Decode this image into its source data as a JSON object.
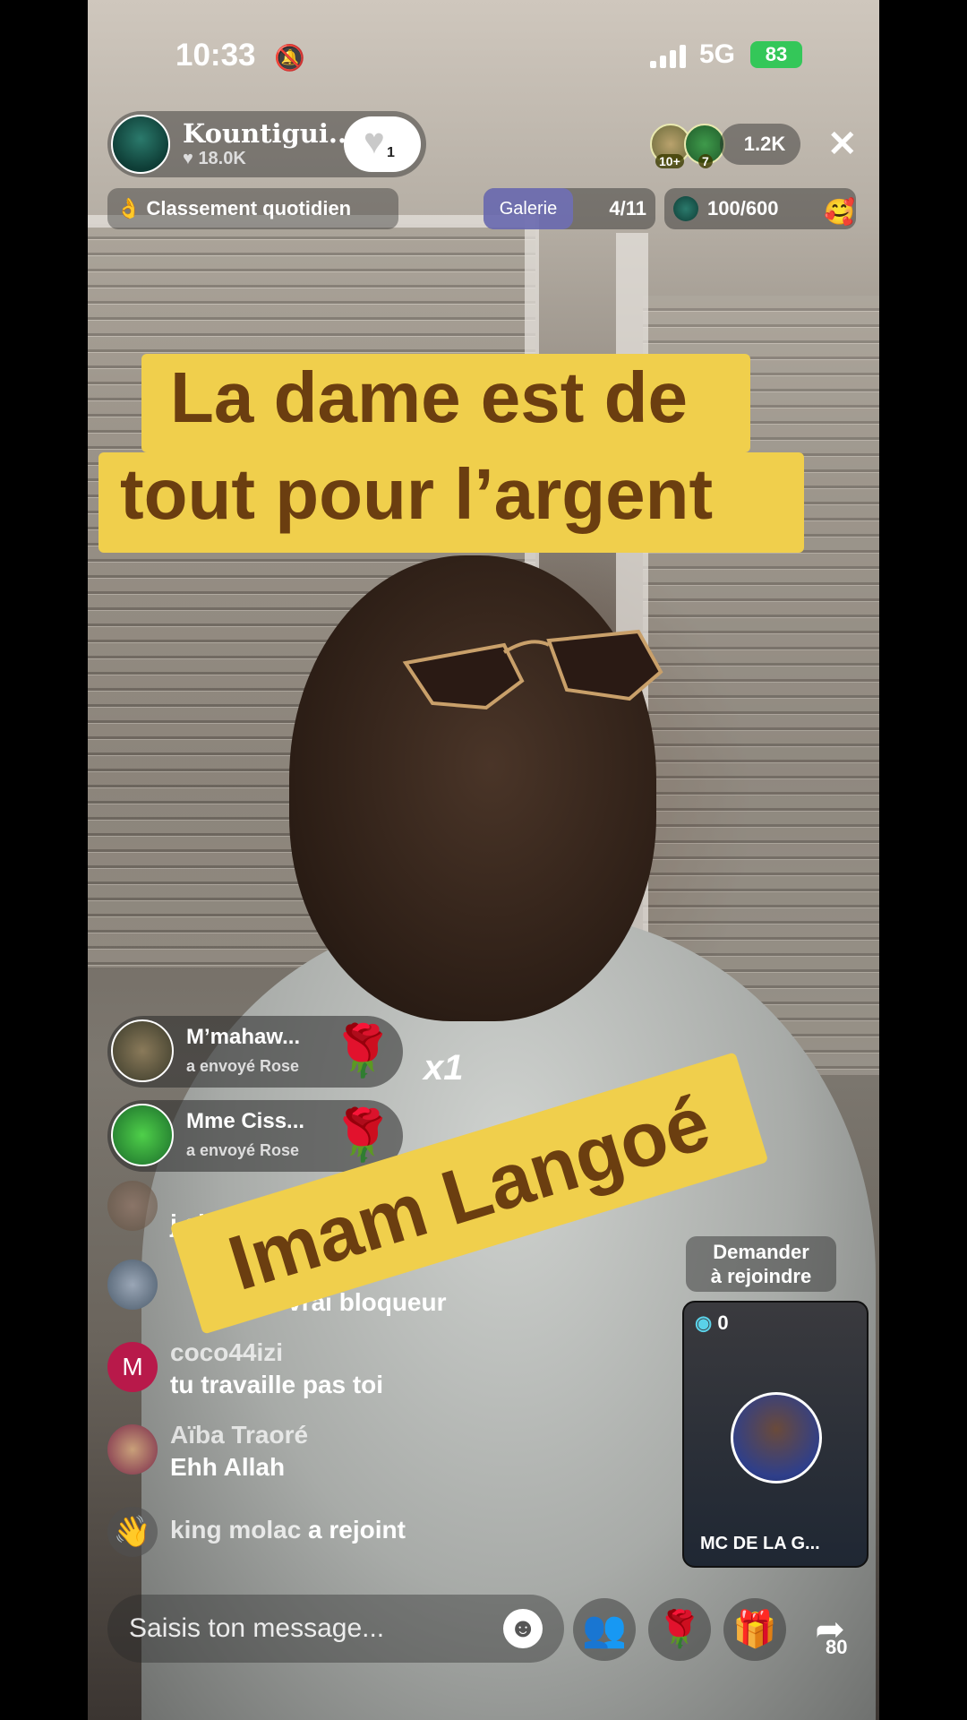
{
  "status": {
    "time": "10:33",
    "network": "5G",
    "battery": "83"
  },
  "host": {
    "name": "Kountigui...",
    "likes": "18.0K",
    "follow_count": "1"
  },
  "viewers": {
    "badge1": "10+",
    "badge2": "7",
    "count": "1.2K"
  },
  "ranking": {
    "label": "Classement quotidien"
  },
  "gallery": {
    "label": "Galerie",
    "progress": "4/11"
  },
  "goal": {
    "progress": "100/600"
  },
  "captions": {
    "line1": "La dame est de",
    "line2": "tout pour l’argent",
    "overlay": "Imam Langoé"
  },
  "gifts": [
    {
      "name": "M’mahaw...",
      "action": "a envoyé  Rose"
    },
    {
      "name": "Mme Ciss...",
      "action": "a envoyé  Rose"
    }
  ],
  "gift_multiplier": "x1",
  "chat": [
    {
      "name": "",
      "message": "j ai"
    },
    {
      "name": "",
      "message": "le vrai bloqueur"
    },
    {
      "name": "coco44izi",
      "message": "tu travaille pas toi",
      "avatar_letter": "M"
    },
    {
      "name": "Aïba Traoré",
      "message": "Ehh Allah"
    }
  ],
  "join": {
    "name": "king molac",
    "action": "a rejoint"
  },
  "request_join": {
    "label_line1": "Demander",
    "label_line2": "à rejoindre"
  },
  "guest": {
    "coins": "0",
    "name": "MC DE LA G..."
  },
  "input": {
    "placeholder": "Saisis ton message..."
  },
  "share": {
    "count": "80"
  },
  "colors": {
    "caption_bg": "#f0cf4c",
    "caption_text": "#6b3e10",
    "battery": "#34c759"
  }
}
